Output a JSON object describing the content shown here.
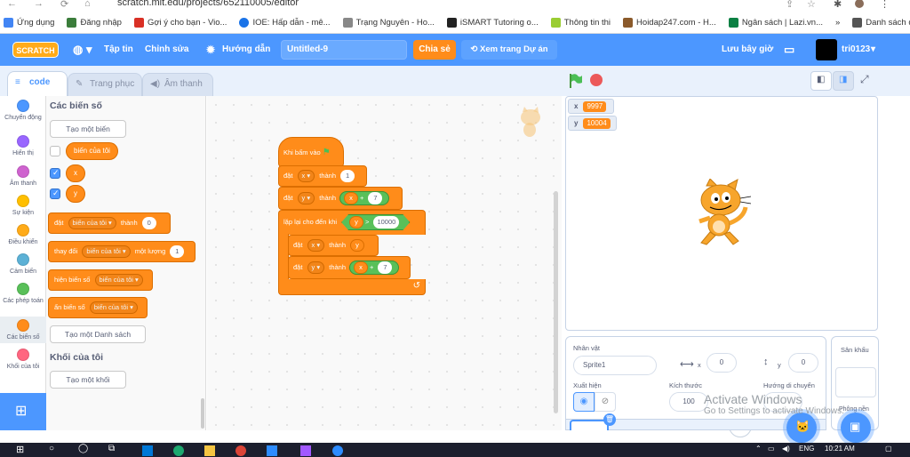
{
  "browser": {
    "url": "scratch.mit.edu/projects/652110005/editor",
    "bookmarks": [
      {
        "label": "Ứng dụng",
        "color": "#4285f4"
      },
      {
        "label": "Đăng nhập",
        "color": "#3b7d3b"
      },
      {
        "label": "Gợi ý cho bạn - Vio...",
        "color": "#d93025"
      },
      {
        "label": "IOE: Hấp dẫn - mê...",
        "color": "#1a73e8"
      },
      {
        "label": "Trạng Nguyên - Ho...",
        "color": "#888888"
      },
      {
        "label": "iSMART Tutoring o...",
        "color": "#222222"
      },
      {
        "label": "Thông tin thi",
        "color": "#9acd32"
      },
      {
        "label": "Hoidap247.com - H...",
        "color": "#8b5a2b"
      },
      {
        "label": "Ngân sách | Lazi.vn...",
        "color": "#0b8043"
      },
      {
        "label": "»",
        "color": ""
      },
      {
        "label": "Danh sách đọc",
        "color": "#555555"
      }
    ]
  },
  "menu": {
    "logo": "SCRATCH",
    "file": "Tập tin",
    "edit": "Chỉnh sửa",
    "tutorials": "Hướng dẫn",
    "project_title": "Untitled-9",
    "share": "Chia sẻ",
    "see_project": "Xem trang Dự án",
    "save_now": "Lưu bây giờ",
    "username": "tri0123"
  },
  "tabs": {
    "code": "code",
    "costumes": "Trang phục",
    "sounds": "Âm thanh"
  },
  "categories": [
    {
      "label": "Chuyển động",
      "color": "#4c97ff"
    },
    {
      "label": "Hiển thị",
      "color": "#9966ff"
    },
    {
      "label": "Âm thanh",
      "color": "#cf63cf"
    },
    {
      "label": "Sự kiện",
      "color": "#ffbf00"
    },
    {
      "label": "Điều khiển",
      "color": "#ffab19"
    },
    {
      "label": "Cảm biến",
      "color": "#5cb1d6"
    },
    {
      "label": "Các phép toán",
      "color": "#59c059"
    },
    {
      "label": "Các biến số",
      "color": "#ff8c1a"
    },
    {
      "label": "Khối của tôi",
      "color": "#ff6680"
    }
  ],
  "palette": {
    "heading_vars": "Các biến số",
    "make_var": "Tạo một biến",
    "var_my": "biến của tôi",
    "var_x": "x",
    "var_y": "y",
    "set_word": "đặt",
    "to_word": "thành",
    "set_value": "0",
    "change_word": "thay đổi",
    "by_word": "một lượng",
    "change_value": "1",
    "show_var": "hiện biến số",
    "hide_var": "ẩn biến số",
    "make_list": "Tạo một Danh sách",
    "heading_myblocks": "Khối của tôi",
    "make_block": "Tạo một khối"
  },
  "script": {
    "hat": "Khi bấm vào",
    "set": "đặt",
    "to": "thành",
    "var_x": "x",
    "var_y": "y",
    "val1": "1",
    "plus": "+",
    "val7": "7",
    "repeat_until": "lặp lại cho đến khi",
    "gt": ">",
    "limit": "10000"
  },
  "stage": {
    "monitors": [
      {
        "name": "x",
        "value": "9997"
      },
      {
        "name": "y",
        "value": "10004"
      }
    ]
  },
  "sprite_info": {
    "sprite_label": "Nhân vật",
    "sprite_name": "Sprite1",
    "x_label": "x",
    "x_value": "0",
    "y_label": "y",
    "y_value": "0",
    "show_label": "Xuất hiện",
    "size_label": "Kích thước",
    "size_value": "100",
    "direction_label": "Hướng di chuyển",
    "stage_label": "Sân khấu",
    "backdrops_label": "Phông nền"
  },
  "watermark": {
    "title": "Activate Windows",
    "subtitle": "Go to Settings to activate Windows."
  },
  "taskbar": {
    "lang": "ENG",
    "time": "10:21 AM"
  },
  "colors": {
    "scratch_blue": "#4c97ff",
    "variables_orange": "#ff8c1a",
    "operators_green": "#59c059",
    "events_yellow": "#ffbf00"
  }
}
